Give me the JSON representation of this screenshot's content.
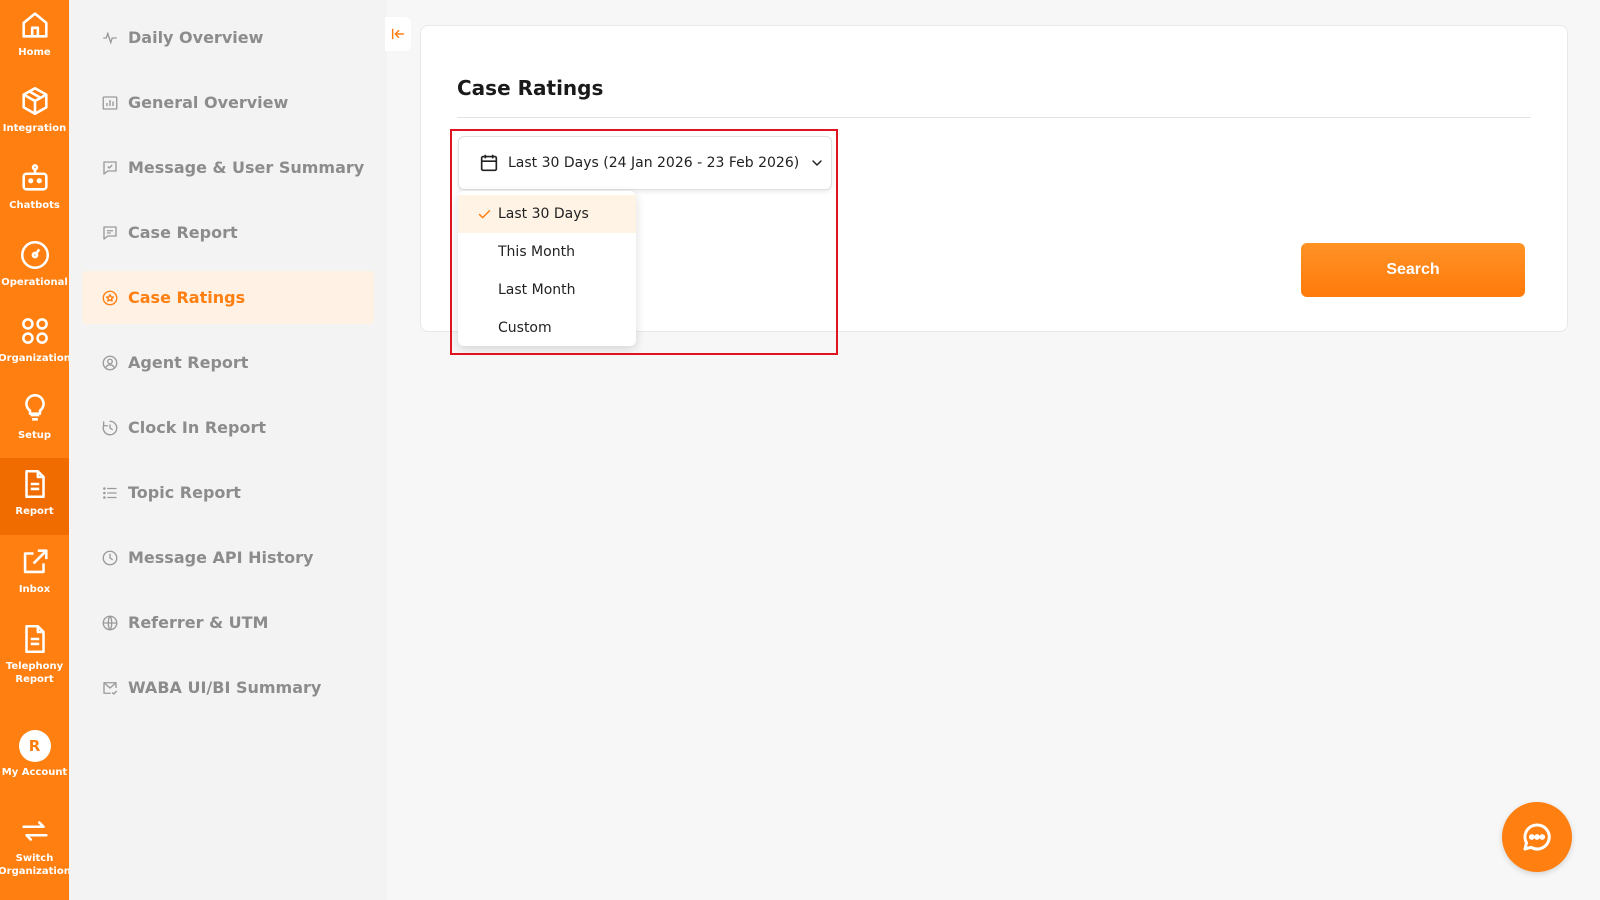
{
  "rail": {
    "items": [
      {
        "label": "Home",
        "icon": "home-icon"
      },
      {
        "label": "Integration",
        "icon": "cube-icon"
      },
      {
        "label": "Chatbots",
        "icon": "robot-icon"
      },
      {
        "label": "Operational",
        "icon": "gauge-icon"
      },
      {
        "label": "Organization",
        "icon": "grid-circles-icon"
      },
      {
        "label": "Setup",
        "icon": "lightbulb-icon"
      },
      {
        "label": "Report",
        "icon": "document-icon",
        "active": true
      },
      {
        "label": "Inbox",
        "icon": "external-link-icon"
      },
      {
        "label_line1": "Telephony",
        "label_line2": "Report",
        "icon": "document-icon"
      },
      {
        "label": "My Account",
        "avatar": "R"
      },
      {
        "label_line1": "Switch",
        "label_line2": "Organization",
        "icon": "switch-arrows-icon"
      }
    ]
  },
  "sidebar": {
    "items": [
      {
        "label": "Daily Overview",
        "icon": "pulse-icon"
      },
      {
        "label": "General Overview",
        "icon": "bar-chart-icon"
      },
      {
        "label": "Message & User Summary",
        "icon": "message-check-icon"
      },
      {
        "label": "Case Report",
        "icon": "message-lines-icon"
      },
      {
        "label": "Case Ratings",
        "icon": "star-circle-icon",
        "active": true
      },
      {
        "label": "Agent Report",
        "icon": "user-circle-icon"
      },
      {
        "label": "Clock In Report",
        "icon": "clock-arrow-icon"
      },
      {
        "label": "Topic Report",
        "icon": "list-icon"
      },
      {
        "label": "Message API History",
        "icon": "clock-icon"
      },
      {
        "label": "Referrer & UTM",
        "icon": "globe-icon"
      },
      {
        "label": "WABA UI/BI Summary",
        "icon": "mail-check-icon"
      }
    ]
  },
  "main": {
    "title": "Case Ratings",
    "date_select": {
      "value": "Last 30 Days (24 Jan 2026 - 23 Feb 2026)",
      "options": [
        {
          "label": "Last 30 Days",
          "selected": true
        },
        {
          "label": "This Month"
        },
        {
          "label": "Last Month"
        },
        {
          "label": "Custom"
        }
      ]
    },
    "search_label": "Search"
  },
  "colors": {
    "brand": "#ff7f11",
    "highlight": "#e0141e"
  }
}
